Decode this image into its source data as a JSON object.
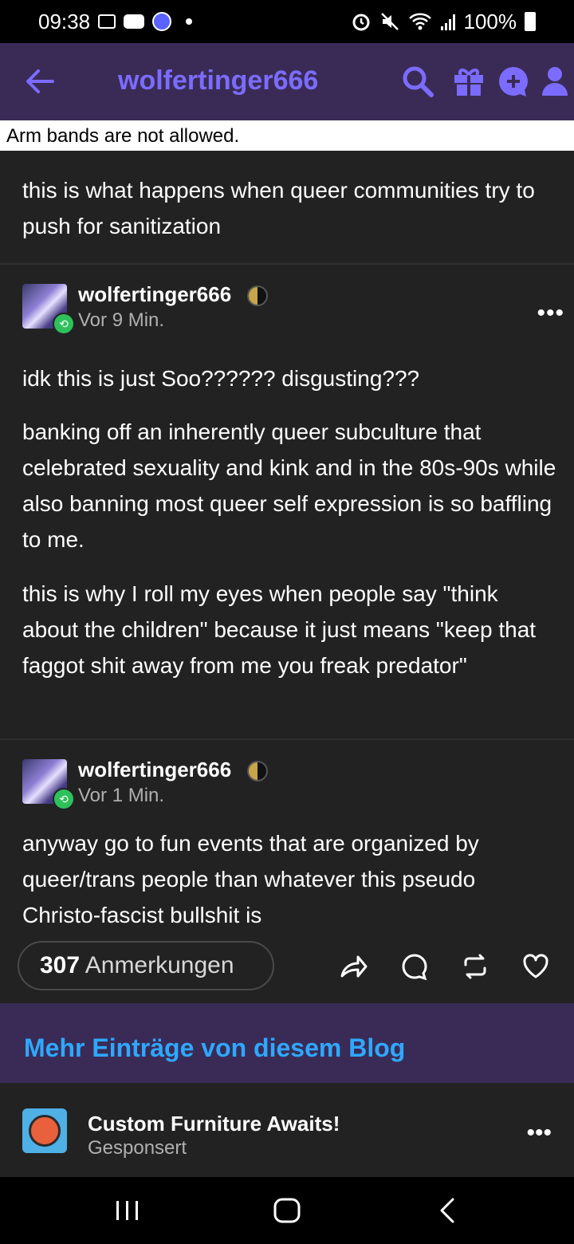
{
  "status_bar": {
    "time": "09:38",
    "battery": "100%",
    "icons": [
      "gallery-icon",
      "youtube-icon",
      "app-avatar-icon",
      "notification-dot",
      "alarm-icon",
      "mute-icon",
      "wifi-icon",
      "signal-icon",
      "battery-icon"
    ]
  },
  "header": {
    "title": "wolfertinger666",
    "accent_color": "#7b6cff",
    "background": "#3a2b56",
    "icons": [
      "back-arrow-icon",
      "search-icon",
      "gift-icon",
      "message-plus-icon",
      "person-icon"
    ]
  },
  "banner": {
    "text": "Arm bands are not allowed."
  },
  "intro_text": "this is what happens when queer communities try to push for sanitization",
  "posts": [
    {
      "username": "wolfertinger666",
      "time": "Vor 9 Min.",
      "paragraphs": [
        "idk this is just Soo?????? disgusting???",
        "banking off an inherently queer subculture that celebrated sexuality and kink and in the 80s-90s while also banning most queer self expression is so baffling to me.",
        "this is why I roll my eyes when people say \"think about the children\" because it just means \"keep that faggot shit away from me you freak predator\""
      ]
    },
    {
      "username": "wolfertinger666",
      "time": "Vor 1 Min.",
      "paragraphs": [
        "anyway go to fun events that are organized by queer/trans people than whatever this pseudo Christo-fascist bullshit is"
      ]
    }
  ],
  "notes": {
    "count": "307",
    "label": "Anmerkungen"
  },
  "actions": [
    "share-icon",
    "comment-icon",
    "reblog-icon",
    "like-icon"
  ],
  "more_posts": {
    "title": "Mehr Einträge von diesem Blog",
    "color": "#2ea8ff"
  },
  "sponsored": {
    "title": "Custom Furniture Awaits!",
    "subtitle": "Gesponsert"
  },
  "nav_bar": [
    "recents-icon",
    "home-icon",
    "back-icon"
  ]
}
